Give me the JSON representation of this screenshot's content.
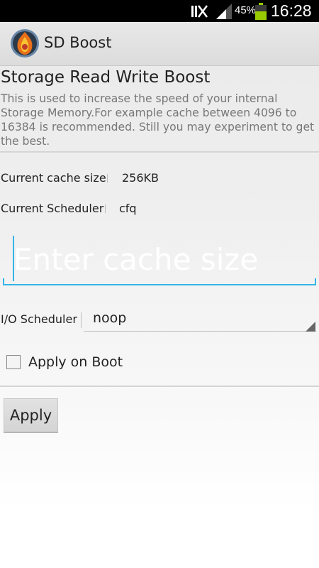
{
  "status_bar": {
    "battery_percent": "45%",
    "time": "16:28",
    "icons": [
      "no-signal-icon",
      "cell-signal-icon",
      "battery-charging-icon"
    ],
    "battery_level": 0.45,
    "battery_color": "#99cc00"
  },
  "action_bar": {
    "title": "SD Boost",
    "icon": "app-flame-logo-icon"
  },
  "main": {
    "heading": "Storage Read Write Boost",
    "description": "This is used to increase the speed of your internal Storage Memory.For example cache between 4096 to 16384 is recommended. Still you may experiment to get the best.",
    "current_cache": {
      "label": "Current cache size",
      "value": "256KB"
    },
    "current_scheduler": {
      "label": "Current Scheduler",
      "value": "cfq"
    },
    "cache_input": {
      "placeholder": "Enter cache size",
      "value": ""
    },
    "io_scheduler": {
      "label": "I/O Scheduler",
      "selected": "noop"
    },
    "apply_on_boot": {
      "label": "Apply on Boot",
      "checked": false
    },
    "apply_button": "Apply"
  },
  "colors": {
    "accent": "#33b5e5",
    "status_bar_bg": "#000000"
  }
}
